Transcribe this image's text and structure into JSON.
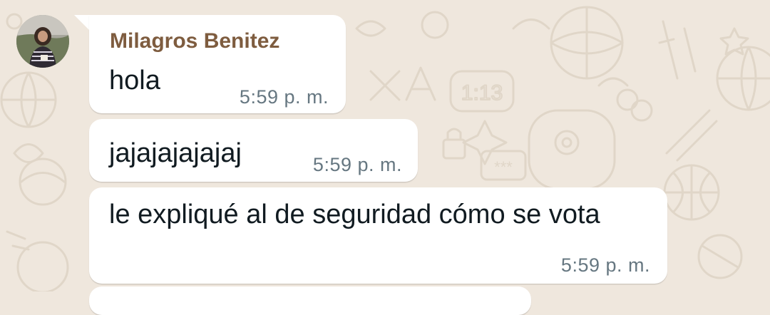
{
  "chat": {
    "contact_avatar_icon": "profile-photo-icon",
    "messages": [
      {
        "sender": "Milagros Benitez",
        "text": "hola",
        "time": "5:59 p. m."
      },
      {
        "text": "jajajajajajaj",
        "time": "5:59 p. m."
      },
      {
        "text": "le expliqué al de seguridad cómo se vota",
        "time": "5:59 p. m."
      }
    ]
  },
  "colors": {
    "wallpaper": "#efe7dd",
    "bubble": "#ffffff",
    "sender_name": "#7e5c3f",
    "message_text": "#111b21",
    "timestamp": "#667781"
  }
}
